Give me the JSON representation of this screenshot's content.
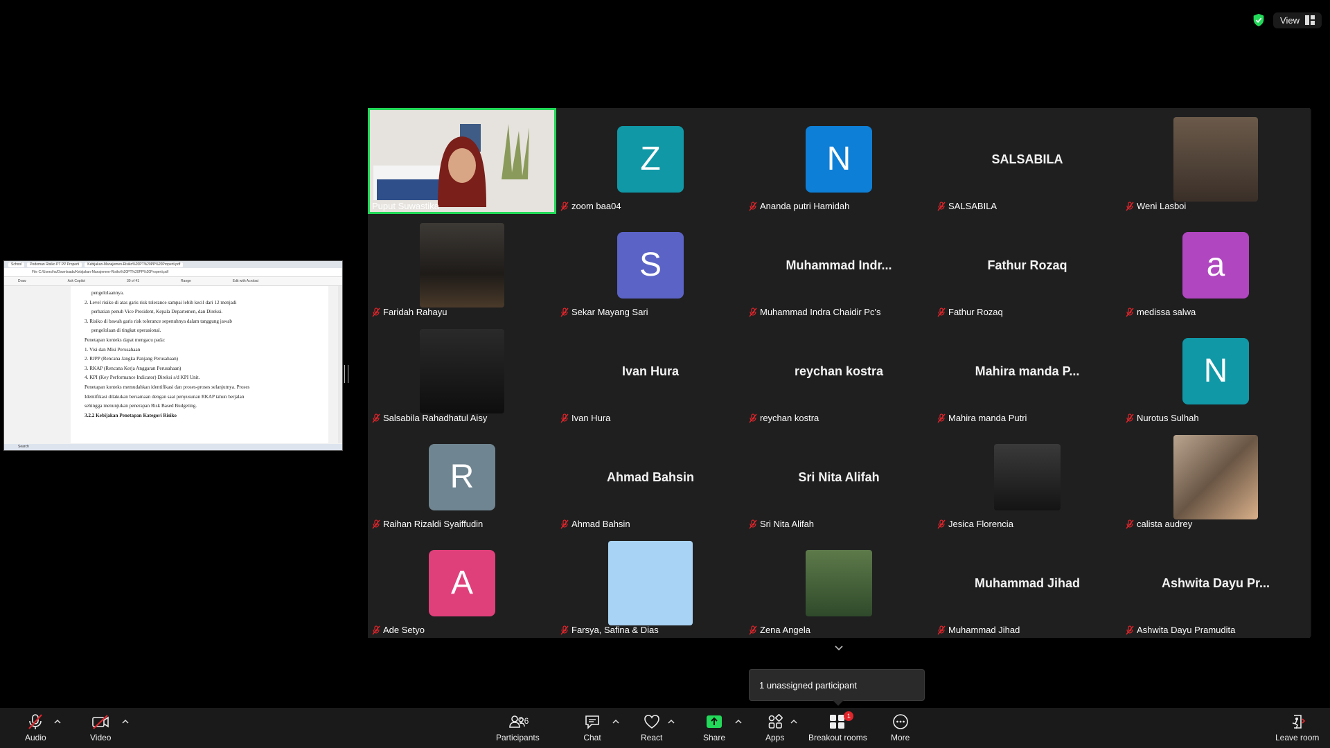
{
  "topbar": {
    "view_label": "View"
  },
  "share": {
    "tabs": [
      "School",
      "Pedoman Risiko PT PP Properti",
      "Kebijakan-Manajemen-Risiko%20PT%20PP%20Properti.pdf"
    ],
    "address": "File   C:/Users/hs/Downloads/Kebijakan-Manajemen-Risiko%20PT%20PP%20Properti.pdf",
    "toolbar_items": [
      "Draw",
      "Ask Copilot",
      "30  of 41",
      "Range",
      "Edit with Acrobat"
    ],
    "lines": [
      "pengelolaannya.",
      "2. Level risiko di atas garis risk tolerance sampai lebih kecil dari 12 menjadi",
      "perhatian penuh Vice President, Kepala Departemen, dan Direksi.",
      "3. Risiko di bawah garis risk tolerance sepenuhnya dalam tanggung jawab",
      "pengelolaan di tingkat operasional.",
      "Penetapan konteks dapat mengacu pada:",
      "1. Visi dan Misi Perusahaan",
      "2. RJPP (Rencana Jangka Panjang Perusahaan)",
      "3. RKAP (Rencana Kerja Anggaran Perusahaan)",
      "4. KPI (Key Performance Indicator) Direksi s/d KPI Unit.",
      "Penetapan konteks memudahkan identifikasi dan proses-proses selanjutnya. Proses",
      "Identifikasi dilakukan bersamaan dengan saat penyusunan RKAP tahun berjalan",
      "sehingga menunjukan penerapan Risk Based Budgeting.",
      "3.2.2   Kebijakan Penetapan Kategori Risiko"
    ],
    "taskbar": "Search"
  },
  "tiles": [
    {
      "name": "Puput Suwastika",
      "type": "video",
      "muted": false
    },
    {
      "name": "zoom baa04",
      "type": "avatar",
      "initial": "Z",
      "color": "#1098a7",
      "muted": true
    },
    {
      "name": "Ananda putri Hamidah",
      "type": "avatar",
      "initial": "N",
      "color": "#0e7fd6",
      "muted": true
    },
    {
      "name": "SALSABILA",
      "type": "text",
      "display": "SALSABILA",
      "muted": true
    },
    {
      "name": "Weni Lasboi",
      "type": "photo",
      "muted": true
    },
    {
      "name": "Faridah Rahayu",
      "type": "photo",
      "muted": true
    },
    {
      "name": "Sekar Mayang Sari",
      "type": "avatar",
      "initial": "S",
      "color": "#5b63c6",
      "muted": true
    },
    {
      "name": "Muhammad Indra Chaidir Pc's",
      "type": "text",
      "display": "Muhammad  Indr...",
      "muted": true
    },
    {
      "name": "Fathur Rozaq",
      "type": "text",
      "display": "Fathur Rozaq",
      "muted": true
    },
    {
      "name": "medissa salwa",
      "type": "avatar",
      "initial": "a",
      "color": "#b046c0",
      "muted": true
    },
    {
      "name": "Salsabila Rahadhatul Aisy",
      "type": "photo",
      "muted": true
    },
    {
      "name": "Ivan Hura",
      "type": "text",
      "display": "Ivan Hura",
      "muted": true
    },
    {
      "name": "reychan kostra",
      "type": "text",
      "display": "reychan kostra",
      "muted": true
    },
    {
      "name": "Mahira manda Putri",
      "type": "text",
      "display": "Mahira manda P...",
      "muted": true
    },
    {
      "name": "Nurotus Sulhah",
      "type": "avatar",
      "initial": "N",
      "color": "#1098a7",
      "muted": true
    },
    {
      "name": "Raihan Rizaldi Syaiffudin",
      "type": "avatar",
      "initial": "R",
      "color": "#6f8591",
      "muted": true
    },
    {
      "name": "Ahmad Bahsin",
      "type": "text",
      "display": "Ahmad Bahsin",
      "muted": true
    },
    {
      "name": "Sri Nita Alifah",
      "type": "text",
      "display": "Sri Nita Alifah",
      "muted": true
    },
    {
      "name": "Jesica Florencia",
      "type": "photo-sm",
      "muted": true
    },
    {
      "name": "calista audrey",
      "type": "photo",
      "muted": true
    },
    {
      "name": "Ade Setyo",
      "type": "avatar",
      "initial": "A",
      "color": "#e0407a",
      "muted": true
    },
    {
      "name": "Farsya, Safina & Dias",
      "type": "photo",
      "muted": true
    },
    {
      "name": "Zena Angela",
      "type": "photo-sm",
      "muted": true
    },
    {
      "name": "Muhammad Jihad",
      "type": "text",
      "display": "Muhammad Jihad",
      "muted": true
    },
    {
      "name": "Ashwita Dayu Pramudita",
      "type": "text",
      "display": "Ashwita Dayu Pr...",
      "muted": true
    }
  ],
  "popup": {
    "text": "1 unassigned participant"
  },
  "toolbar": {
    "audio": "Audio",
    "video": "Video",
    "participants": "Participants",
    "participants_count": "26",
    "chat": "Chat",
    "react": "React",
    "share": "Share",
    "apps": "Apps",
    "breakout": "Breakout rooms",
    "breakout_badge": "1",
    "more": "More",
    "leave": "Leave room"
  },
  "colors": {
    "active_speaker": "#23d959",
    "mute_red": "#e0252b",
    "share_green": "#23d959"
  }
}
